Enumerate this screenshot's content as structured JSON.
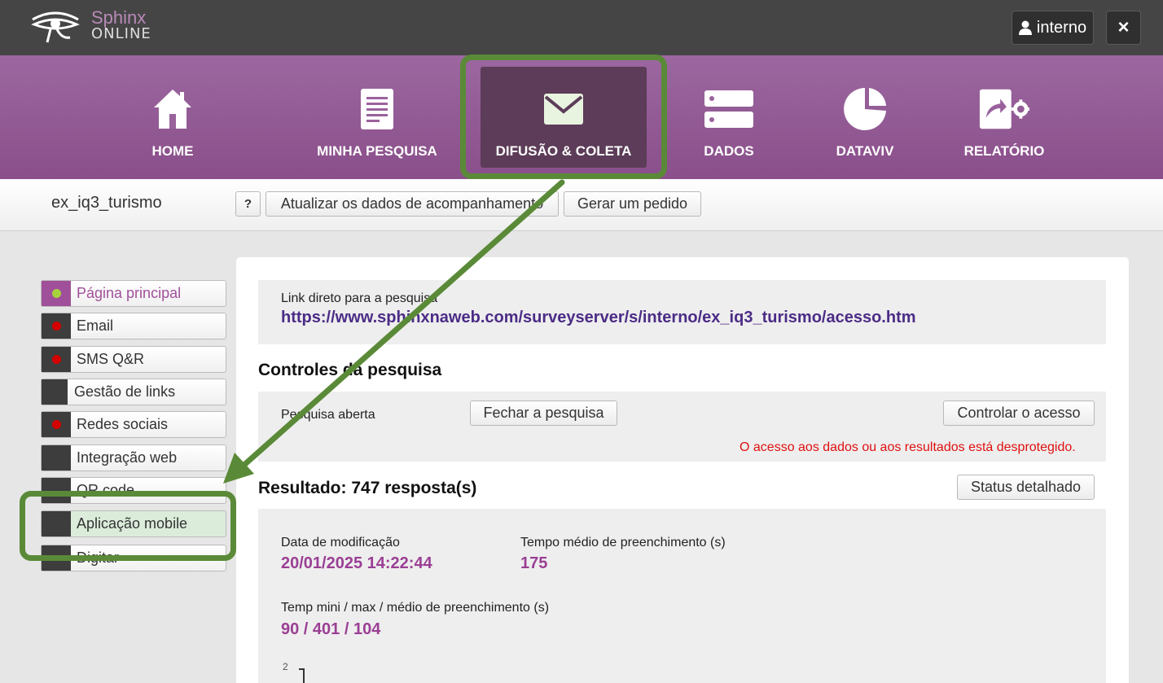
{
  "app": {
    "logo_line1": "Sphinx",
    "logo_line2": "ONLINE",
    "user_label": "interno",
    "close_label": "×"
  },
  "nav": {
    "items": [
      {
        "label": "HOME",
        "icon": "home-icon"
      },
      {
        "label": "MINHA PESQUISA",
        "icon": "document-icon"
      },
      {
        "label": "DIFUSÃO & COLETA",
        "icon": "envelope-icon",
        "active": true
      },
      {
        "label": "DADOS",
        "icon": "server-icon"
      },
      {
        "label": "DATAVIV",
        "icon": "pie-chart-icon"
      },
      {
        "label": "RELATÓRIO",
        "icon": "report-share-icon"
      }
    ]
  },
  "toolbar": {
    "survey_name": "ex_iq3_turismo",
    "help_label": "?",
    "update_label": "Atualizar os dados de acompanhamento",
    "order_label": "Gerar um pedido"
  },
  "sidebar": {
    "items": [
      {
        "label": "Página principal",
        "status": "active"
      },
      {
        "label": "Email",
        "status": "red"
      },
      {
        "label": "SMS Q&R",
        "status": "red"
      },
      {
        "label": "Gestão de links",
        "status": "none"
      },
      {
        "label": "Redes sociais",
        "status": "red"
      },
      {
        "label": "Integração web",
        "status": "none"
      },
      {
        "label": "QR code",
        "status": "none"
      },
      {
        "label": "Aplicação mobile",
        "status": "none"
      },
      {
        "label": "Digitar",
        "status": "none"
      }
    ]
  },
  "main": {
    "link_label": "Link direto para a pesquisa",
    "link_url": "https://www.sphinxnaweb.com/surveyserver/s/interno/ex_iq3_turismo/acesso.htm",
    "controls_title": "Controles da pesquisa",
    "survey_status": "Pesquisa aberta",
    "close_survey_label": "Fechar a pesquisa",
    "control_access_label": "Controlar o acesso",
    "warning": "O acesso aos dados ou aos resultados está desprotegido.",
    "result_title": "Resultado: 747 resposta(s)",
    "detailed_status_label": "Status detalhado",
    "modified_label": "Data de modificação",
    "modified_value": "20/01/2025 14:22:44",
    "avg_time_label": "Tempo médio de preenchimento (s)",
    "avg_time_value": "175",
    "minmax_label": "Temp mini / max / médio de preenchimento (s)",
    "minmax_value": "90 / 401 / 104",
    "chart_axis_tick": "2"
  },
  "colors": {
    "brand_purple": "#9c67a0",
    "active_nav": "#5c3c58",
    "annotation_green": "#5a8a38",
    "status_red": "#d40000",
    "status_active": "#a7d23c"
  }
}
